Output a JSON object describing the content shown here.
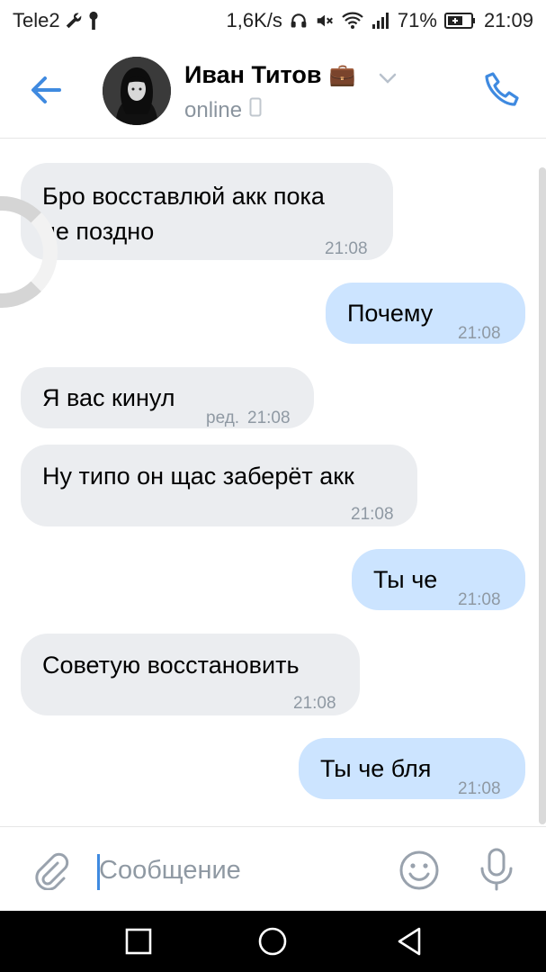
{
  "status_bar": {
    "carrier": "Tele2",
    "speed": "1,6K/s",
    "battery": "71%",
    "time": "21:09",
    "icons": [
      "wrench-icon",
      "key-icon",
      "headphones-icon",
      "mute-icon",
      "wifi-icon",
      "signal-icon",
      "battery-icon"
    ]
  },
  "header": {
    "contact_name": "Иван Титов",
    "badge_emoji": "💼",
    "status": "online",
    "icons": [
      "back-arrow-icon",
      "chevron-down-icon",
      "phone-device-icon",
      "call-icon"
    ]
  },
  "messages": [
    {
      "direction": "in",
      "text_lines": [
        "Бро восставлюй акк пока",
        "не поздно"
      ],
      "time": "21:08"
    },
    {
      "direction": "out",
      "text": "Почему",
      "time": "21:08"
    },
    {
      "direction": "in",
      "text": "Я вас кинул",
      "edited": "ред.",
      "time": "21:08"
    },
    {
      "direction": "in",
      "text": "Ну типо он щас заберёт акк",
      "time": "21:08"
    },
    {
      "direction": "out",
      "text": "Ты че",
      "time": "21:08"
    },
    {
      "direction": "in",
      "text": "Советую восстановить",
      "time": "21:08"
    },
    {
      "direction": "out",
      "text": "Ты че бля",
      "time": "21:08"
    }
  ],
  "input_bar": {
    "placeholder": "Сообщение",
    "icons": [
      "paperclip-icon",
      "emoji-icon",
      "microphone-icon"
    ]
  },
  "nav_bar": {
    "icons": [
      "recents-icon",
      "home-icon",
      "back-icon"
    ]
  },
  "colors": {
    "accent": "#3f8ae0",
    "incoming_bubble": "#ebedf0",
    "outgoing_bubble": "#cce4ff",
    "time_text": "#8f99a3"
  }
}
